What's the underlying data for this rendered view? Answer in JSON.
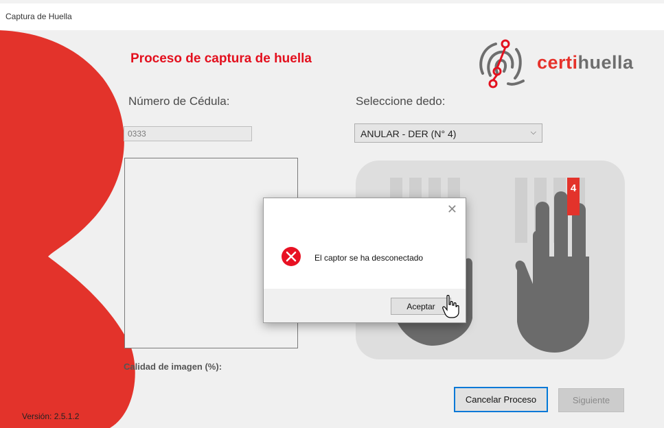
{
  "window": {
    "title": "Captura de Huella"
  },
  "header": {
    "title": "Proceso de captura de huella"
  },
  "logo": {
    "part1": "certi",
    "part2": "huella"
  },
  "form": {
    "cedula_label": "Número de Cédula:",
    "cedula_value": "0333",
    "finger_label": "Seleccione dedo:",
    "finger_selected": "ANULAR - DER (N° 4)"
  },
  "hands": {
    "selected_finger_number": "4"
  },
  "quality": {
    "label": "Calidad de imagen (%):"
  },
  "buttons": {
    "cancel": "Cancelar Proceso",
    "next": "Siguiente"
  },
  "footer": {
    "version": "Versión: 2.5.1.2"
  },
  "dialog": {
    "message": "El captor se ha desconectado",
    "ok": "Aceptar"
  },
  "colors": {
    "brand_red": "#e3101e",
    "accent_blue": "#0078d7",
    "hand_gray": "#6b6b6b"
  }
}
